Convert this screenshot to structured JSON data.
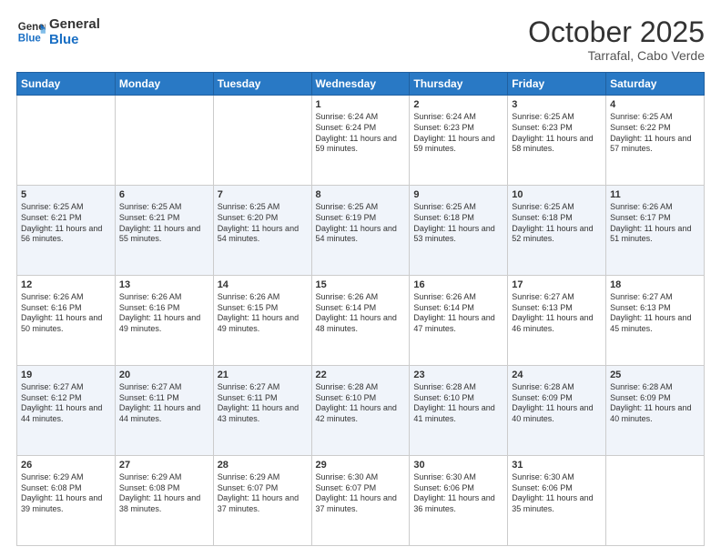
{
  "header": {
    "logo_line1": "General",
    "logo_line2": "Blue",
    "month_title": "October 2025",
    "location": "Tarrafal, Cabo Verde"
  },
  "weekdays": [
    "Sunday",
    "Monday",
    "Tuesday",
    "Wednesday",
    "Thursday",
    "Friday",
    "Saturday"
  ],
  "weeks": [
    [
      {
        "day": "",
        "info": ""
      },
      {
        "day": "",
        "info": ""
      },
      {
        "day": "",
        "info": ""
      },
      {
        "day": "1",
        "info": "Sunrise: 6:24 AM\nSunset: 6:24 PM\nDaylight: 11 hours and 59 minutes."
      },
      {
        "day": "2",
        "info": "Sunrise: 6:24 AM\nSunset: 6:23 PM\nDaylight: 11 hours and 59 minutes."
      },
      {
        "day": "3",
        "info": "Sunrise: 6:25 AM\nSunset: 6:23 PM\nDaylight: 11 hours and 58 minutes."
      },
      {
        "day": "4",
        "info": "Sunrise: 6:25 AM\nSunset: 6:22 PM\nDaylight: 11 hours and 57 minutes."
      }
    ],
    [
      {
        "day": "5",
        "info": "Sunrise: 6:25 AM\nSunset: 6:21 PM\nDaylight: 11 hours and 56 minutes."
      },
      {
        "day": "6",
        "info": "Sunrise: 6:25 AM\nSunset: 6:21 PM\nDaylight: 11 hours and 55 minutes."
      },
      {
        "day": "7",
        "info": "Sunrise: 6:25 AM\nSunset: 6:20 PM\nDaylight: 11 hours and 54 minutes."
      },
      {
        "day": "8",
        "info": "Sunrise: 6:25 AM\nSunset: 6:19 PM\nDaylight: 11 hours and 54 minutes."
      },
      {
        "day": "9",
        "info": "Sunrise: 6:25 AM\nSunset: 6:18 PM\nDaylight: 11 hours and 53 minutes."
      },
      {
        "day": "10",
        "info": "Sunrise: 6:25 AM\nSunset: 6:18 PM\nDaylight: 11 hours and 52 minutes."
      },
      {
        "day": "11",
        "info": "Sunrise: 6:26 AM\nSunset: 6:17 PM\nDaylight: 11 hours and 51 minutes."
      }
    ],
    [
      {
        "day": "12",
        "info": "Sunrise: 6:26 AM\nSunset: 6:16 PM\nDaylight: 11 hours and 50 minutes."
      },
      {
        "day": "13",
        "info": "Sunrise: 6:26 AM\nSunset: 6:16 PM\nDaylight: 11 hours and 49 minutes."
      },
      {
        "day": "14",
        "info": "Sunrise: 6:26 AM\nSunset: 6:15 PM\nDaylight: 11 hours and 49 minutes."
      },
      {
        "day": "15",
        "info": "Sunrise: 6:26 AM\nSunset: 6:14 PM\nDaylight: 11 hours and 48 minutes."
      },
      {
        "day": "16",
        "info": "Sunrise: 6:26 AM\nSunset: 6:14 PM\nDaylight: 11 hours and 47 minutes."
      },
      {
        "day": "17",
        "info": "Sunrise: 6:27 AM\nSunset: 6:13 PM\nDaylight: 11 hours and 46 minutes."
      },
      {
        "day": "18",
        "info": "Sunrise: 6:27 AM\nSunset: 6:13 PM\nDaylight: 11 hours and 45 minutes."
      }
    ],
    [
      {
        "day": "19",
        "info": "Sunrise: 6:27 AM\nSunset: 6:12 PM\nDaylight: 11 hours and 44 minutes."
      },
      {
        "day": "20",
        "info": "Sunrise: 6:27 AM\nSunset: 6:11 PM\nDaylight: 11 hours and 44 minutes."
      },
      {
        "day": "21",
        "info": "Sunrise: 6:27 AM\nSunset: 6:11 PM\nDaylight: 11 hours and 43 minutes."
      },
      {
        "day": "22",
        "info": "Sunrise: 6:28 AM\nSunset: 6:10 PM\nDaylight: 11 hours and 42 minutes."
      },
      {
        "day": "23",
        "info": "Sunrise: 6:28 AM\nSunset: 6:10 PM\nDaylight: 11 hours and 41 minutes."
      },
      {
        "day": "24",
        "info": "Sunrise: 6:28 AM\nSunset: 6:09 PM\nDaylight: 11 hours and 40 minutes."
      },
      {
        "day": "25",
        "info": "Sunrise: 6:28 AM\nSunset: 6:09 PM\nDaylight: 11 hours and 40 minutes."
      }
    ],
    [
      {
        "day": "26",
        "info": "Sunrise: 6:29 AM\nSunset: 6:08 PM\nDaylight: 11 hours and 39 minutes."
      },
      {
        "day": "27",
        "info": "Sunrise: 6:29 AM\nSunset: 6:08 PM\nDaylight: 11 hours and 38 minutes."
      },
      {
        "day": "28",
        "info": "Sunrise: 6:29 AM\nSunset: 6:07 PM\nDaylight: 11 hours and 37 minutes."
      },
      {
        "day": "29",
        "info": "Sunrise: 6:30 AM\nSunset: 6:07 PM\nDaylight: 11 hours and 37 minutes."
      },
      {
        "day": "30",
        "info": "Sunrise: 6:30 AM\nSunset: 6:06 PM\nDaylight: 11 hours and 36 minutes."
      },
      {
        "day": "31",
        "info": "Sunrise: 6:30 AM\nSunset: 6:06 PM\nDaylight: 11 hours and 35 minutes."
      },
      {
        "day": "",
        "info": ""
      }
    ]
  ]
}
